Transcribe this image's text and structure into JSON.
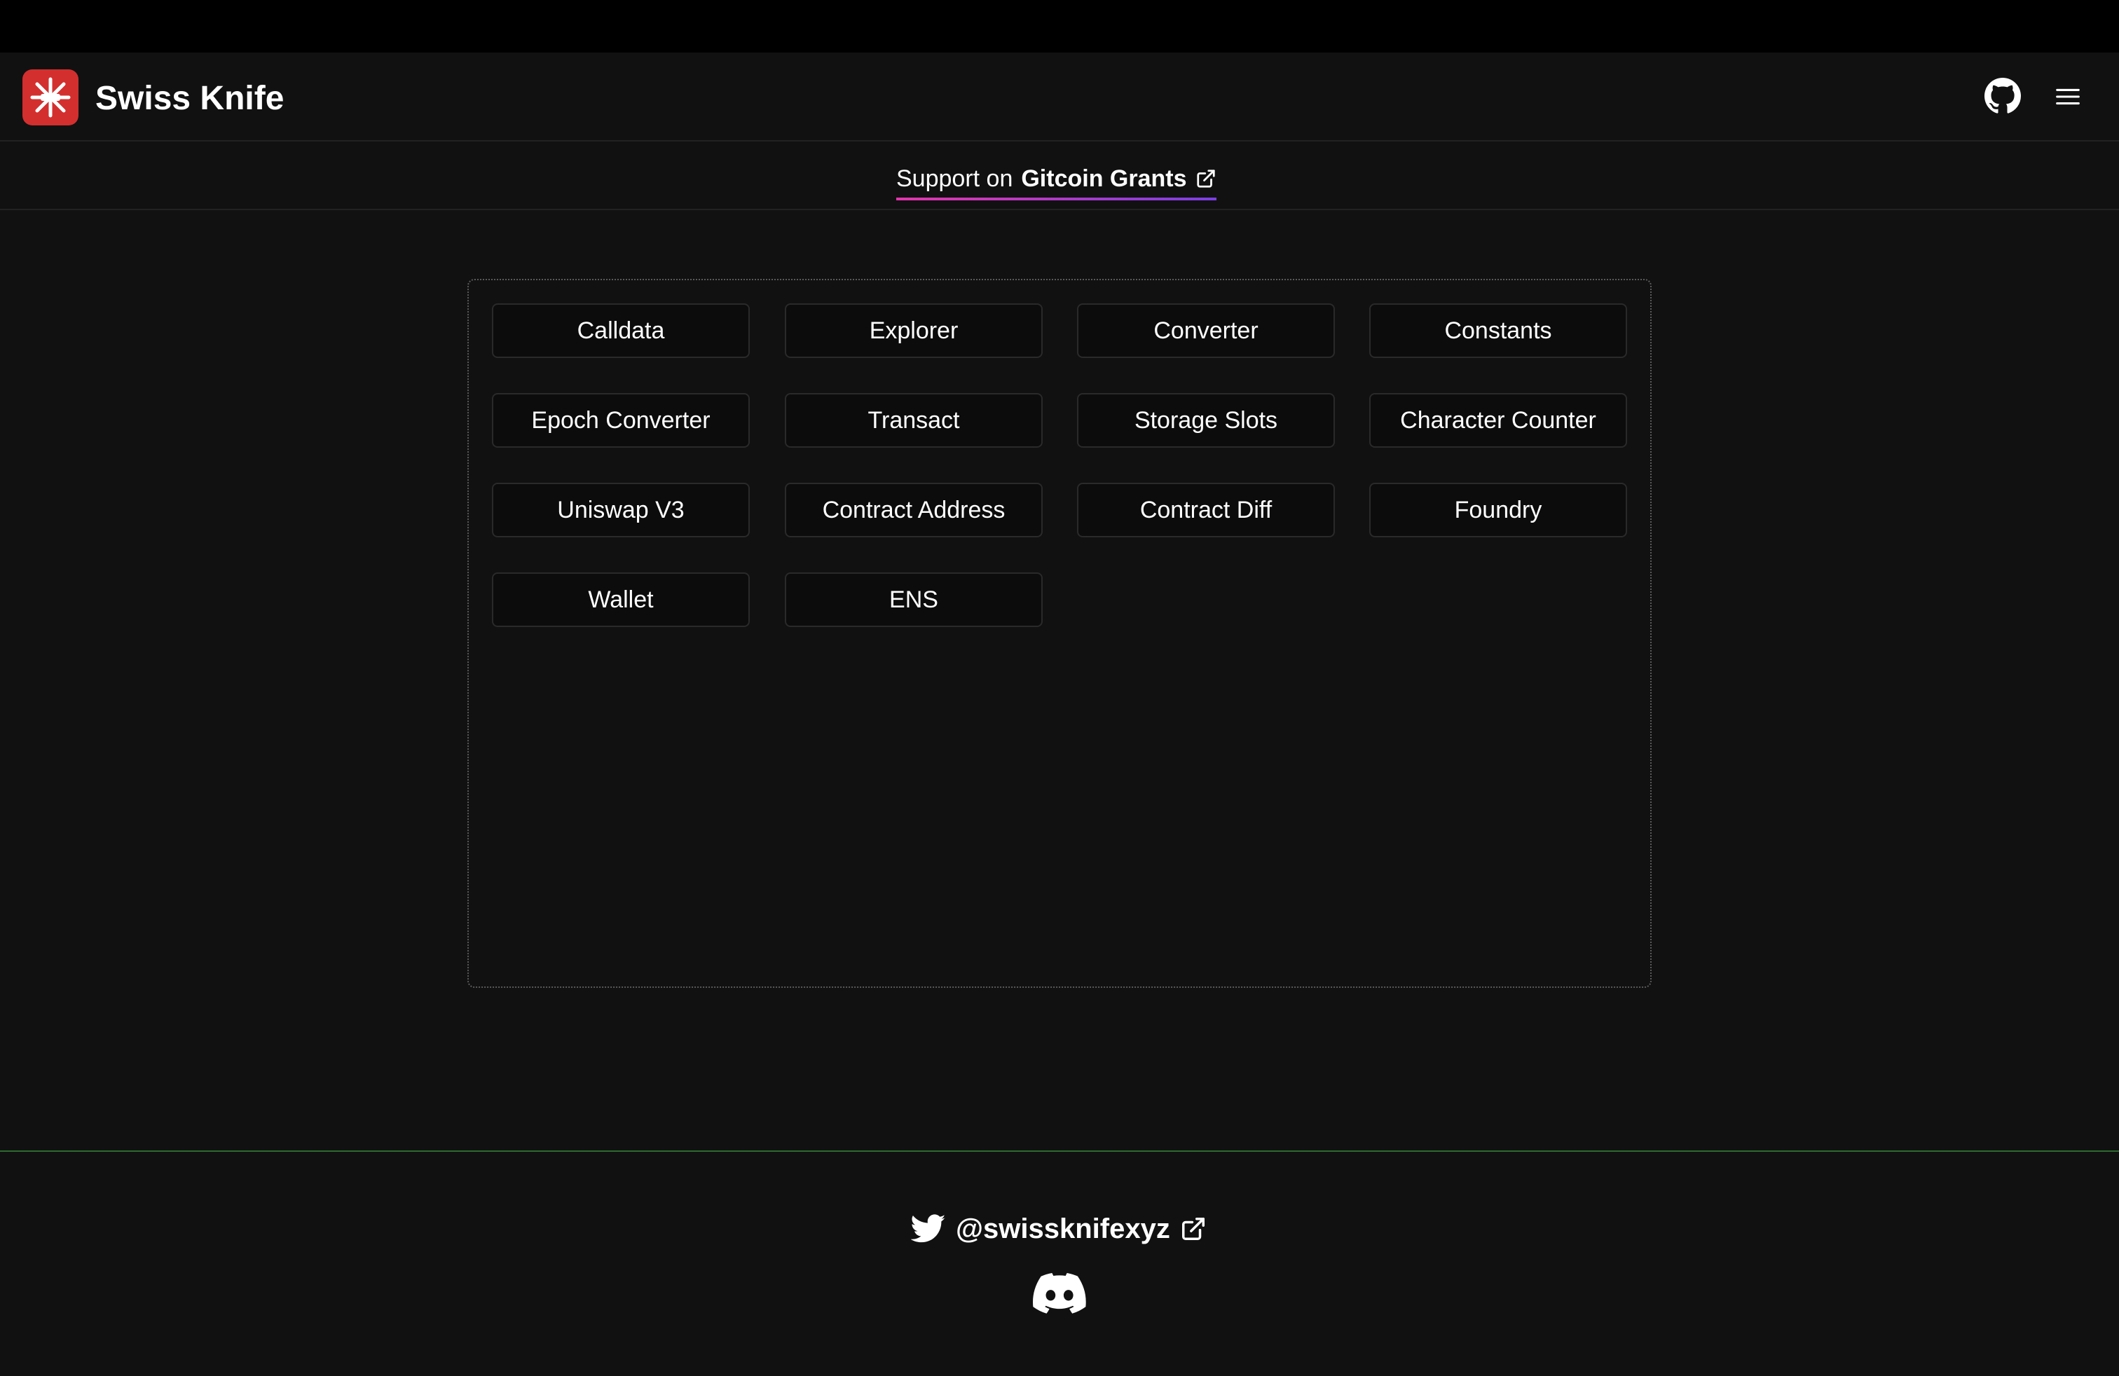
{
  "header": {
    "brand": "Swiss Knife"
  },
  "support": {
    "prefix": "Support on",
    "name": "Gitcoin Grants"
  },
  "tools": [
    {
      "label": "Calldata"
    },
    {
      "label": "Explorer"
    },
    {
      "label": "Converter"
    },
    {
      "label": "Constants"
    },
    {
      "label": "Epoch Converter"
    },
    {
      "label": "Transact"
    },
    {
      "label": "Storage Slots"
    },
    {
      "label": "Character Counter"
    },
    {
      "label": "Uniswap V3"
    },
    {
      "label": "Contract Address"
    },
    {
      "label": "Contract Diff"
    },
    {
      "label": "Foundry"
    },
    {
      "label": "Wallet"
    },
    {
      "label": "ENS"
    }
  ],
  "footer": {
    "twitter_handle": "@swissknifexyz"
  },
  "icons": {
    "logo": "swiss-knife-logo",
    "github": "github-icon",
    "menu": "hamburger-menu-icon",
    "external": "external-link-icon",
    "twitter": "twitter-icon",
    "discord": "discord-icon"
  },
  "colors": {
    "background": "#111111",
    "logo_red": "#d32f2f",
    "support_gradient_start": "#e535ab",
    "support_gradient_end": "#7b3fe4",
    "footer_line": "#2e6b2e"
  }
}
